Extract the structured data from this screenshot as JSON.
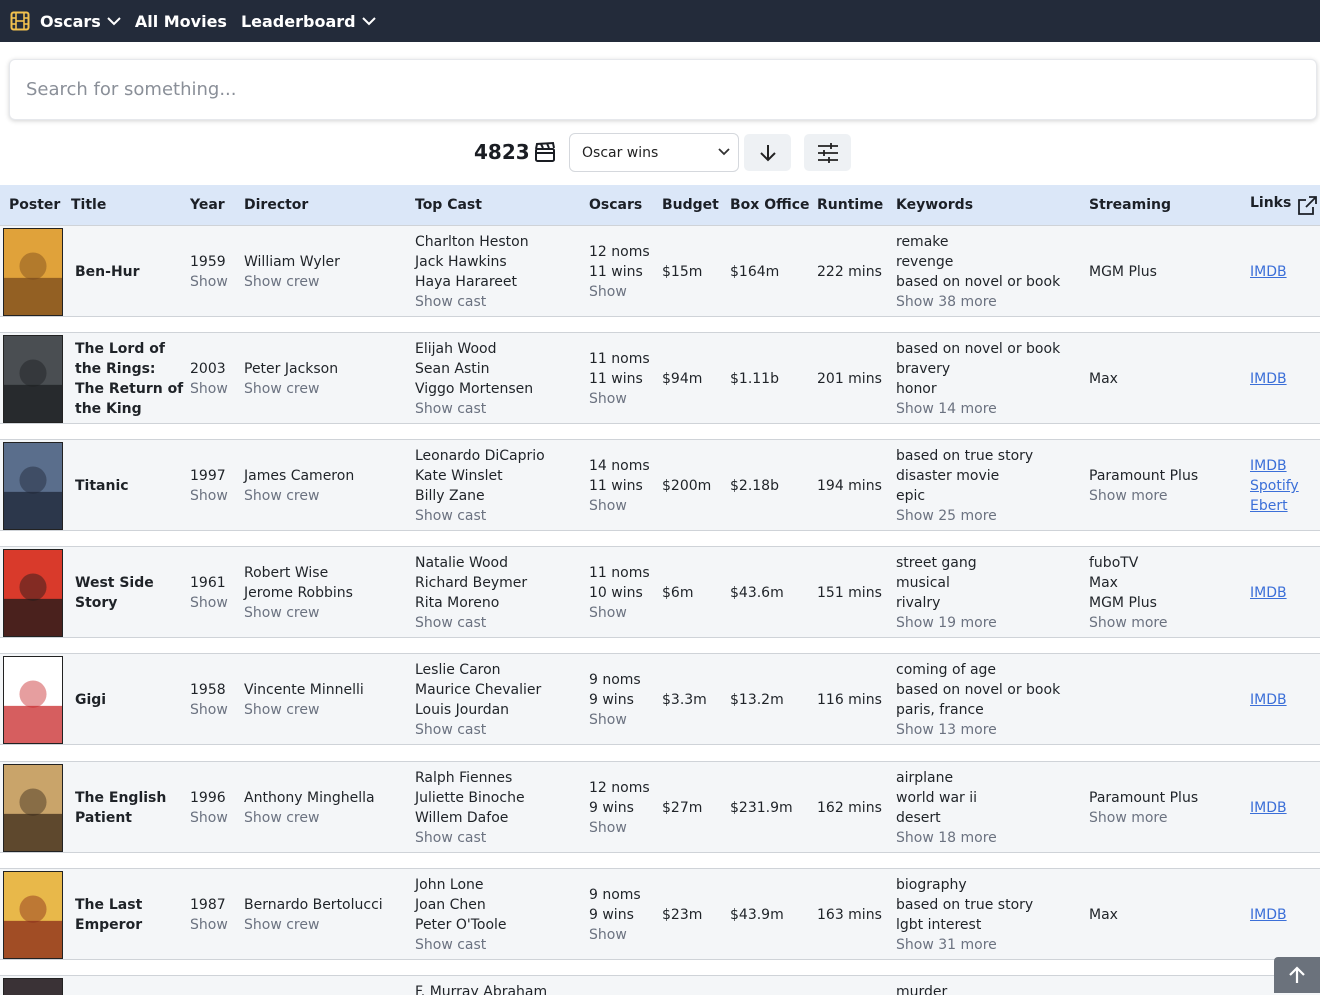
{
  "nav": {
    "brand": "Oscars",
    "all_movies": "All Movies",
    "leaderboard": "Leaderboard"
  },
  "search": {
    "placeholder": "Search for something..."
  },
  "controls": {
    "count": "4823",
    "sort_by": "Oscar wins"
  },
  "table": {
    "headers": {
      "poster": "Poster",
      "title": "Title",
      "year": "Year",
      "director": "Director",
      "top_cast": "Top Cast",
      "oscars": "Oscars",
      "budget": "Budget",
      "box_office": "Box Office",
      "runtime": "Runtime",
      "keywords": "Keywords",
      "streaming": "Streaming",
      "links": "Links"
    },
    "rows": [
      {
        "title": [
          "Ben-Hur"
        ],
        "year": "1959",
        "show": "Show",
        "directors": [
          "William Wyler"
        ],
        "show_crew": "Show crew",
        "cast": [
          "Charlton Heston",
          "Jack Hawkins",
          "Haya Harareet"
        ],
        "show_cast": "Show cast",
        "noms": "12 noms",
        "wins": "11 wins",
        "oscar_show": "Show",
        "budget": "$15m",
        "box_office": "$164m",
        "runtime": "222 mins",
        "keywords": [
          "remake",
          "revenge",
          "based on novel or book"
        ],
        "keywords_more": "Show 38 more",
        "streaming": [
          "MGM Plus"
        ],
        "streaming_more": "",
        "links": [
          "IMDB"
        ],
        "poster_colors": [
          "#e0a23a",
          "#7a4a1c"
        ]
      },
      {
        "title": [
          "The Lord of",
          "the Rings:",
          "The Return of",
          "the King"
        ],
        "year": "2003",
        "show": "Show",
        "directors": [
          "Peter Jackson"
        ],
        "show_crew": "Show crew",
        "cast": [
          "Elijah Wood",
          "Sean Astin",
          "Viggo Mortensen"
        ],
        "show_cast": "Show cast",
        "noms": "11 noms",
        "wins": "11 wins",
        "oscar_show": "Show",
        "budget": "$94m",
        "box_office": "$1.11b",
        "runtime": "201 mins",
        "keywords": [
          "based on novel or book",
          "bravery",
          "honor"
        ],
        "keywords_more": "Show 14 more",
        "streaming": [
          "Max"
        ],
        "streaming_more": "",
        "links": [
          "IMDB"
        ],
        "poster_colors": [
          "#4a4e52",
          "#1c1f22"
        ]
      },
      {
        "title": [
          "Titanic"
        ],
        "year": "1997",
        "show": "Show",
        "directors": [
          "James Cameron"
        ],
        "show_crew": "Show crew",
        "cast": [
          "Leonardo DiCaprio",
          "Kate Winslet",
          "Billy Zane"
        ],
        "show_cast": "Show cast",
        "noms": "14 noms",
        "wins": "11 wins",
        "oscar_show": "Show",
        "budget": "$200m",
        "box_office": "$2.18b",
        "runtime": "194 mins",
        "keywords": [
          "based on true story",
          "disaster movie",
          "epic"
        ],
        "keywords_more": "Show 25 more",
        "streaming": [
          "Paramount Plus"
        ],
        "streaming_more": "Show more",
        "links": [
          "IMDB",
          "Spotify",
          "Ebert"
        ],
        "poster_colors": [
          "#5a6e8c",
          "#1e2636"
        ]
      },
      {
        "title": [
          "West Side",
          "Story"
        ],
        "year": "1961",
        "show": "Show",
        "directors": [
          "Robert Wise",
          "Jerome Robbins"
        ],
        "show_crew": "Show crew",
        "cast": [
          "Natalie Wood",
          "Richard Beymer",
          "Rita Moreno"
        ],
        "show_cast": "Show cast",
        "noms": "11 noms",
        "wins": "10 wins",
        "oscar_show": "Show",
        "budget": "$6m",
        "box_office": "$43.6m",
        "runtime": "151 mins",
        "keywords": [
          "street gang",
          "musical",
          "rivalry"
        ],
        "keywords_more": "Show 19 more",
        "streaming": [
          "fuboTV",
          "Max",
          "MGM Plus"
        ],
        "streaming_more": "Show more",
        "links": [
          "IMDB"
        ],
        "poster_colors": [
          "#d93a2b",
          "#1a1a1a"
        ]
      },
      {
        "title": [
          "Gigi"
        ],
        "year": "1958",
        "show": "Show",
        "directors": [
          "Vincente Minnelli"
        ],
        "show_crew": "Show crew",
        "cast": [
          "Leslie Caron",
          "Maurice Chevalier",
          "Louis Jourdan"
        ],
        "show_cast": "Show cast",
        "noms": "9 noms",
        "wins": "9 wins",
        "oscar_show": "Show",
        "budget": "$3.3m",
        "box_office": "$13.2m",
        "runtime": "116 mins",
        "keywords": [
          "coming of age",
          "based on novel or book",
          "paris, france"
        ],
        "keywords_more": "Show 13 more",
        "streaming": [],
        "streaming_more": "",
        "links": [
          "IMDB"
        ],
        "poster_colors": [
          "#ffffff",
          "#c8282a"
        ]
      },
      {
        "title": [
          "The English",
          "Patient"
        ],
        "year": "1996",
        "show": "Show",
        "directors": [
          "Anthony Minghella"
        ],
        "show_crew": "Show crew",
        "cast": [
          "Ralph Fiennes",
          "Juliette Binoche",
          "Willem Dafoe"
        ],
        "show_cast": "Show cast",
        "noms": "12 noms",
        "wins": "9 wins",
        "oscar_show": "Show",
        "budget": "$27m",
        "box_office": "$231.9m",
        "runtime": "162 mins",
        "keywords": [
          "airplane",
          "world war ii",
          "desert"
        ],
        "keywords_more": "Show 18 more",
        "streaming": [
          "Paramount Plus"
        ],
        "streaming_more": "Show more",
        "links": [
          "IMDB"
        ],
        "poster_colors": [
          "#c9a46a",
          "#3a2a1a"
        ]
      },
      {
        "title": [
          "The Last",
          "Emperor"
        ],
        "year": "1987",
        "show": "Show",
        "directors": [
          "Bernardo Bertolucci"
        ],
        "show_crew": "Show crew",
        "cast": [
          "John Lone",
          "Joan Chen",
          "Peter O'Toole"
        ],
        "show_cast": "Show cast",
        "noms": "9 noms",
        "wins": "9 wins",
        "oscar_show": "Show",
        "budget": "$23m",
        "box_office": "$43.9m",
        "runtime": "163 mins",
        "keywords": [
          "biography",
          "based on true story",
          "lgbt interest"
        ],
        "keywords_more": "Show 31 more",
        "streaming": [
          "Max"
        ],
        "streaming_more": "",
        "links": [
          "IMDB"
        ],
        "poster_colors": [
          "#e8b84a",
          "#8a2a1a"
        ]
      }
    ],
    "partial_row": {
      "cast_first": "F. Murray Abraham",
      "keyword_first": "murder"
    }
  },
  "colors": {
    "nav_bg": "#232b3a",
    "header_bg": "#dbe7f8",
    "row_bg": "#f4f6f8",
    "link": "#3b6fd8",
    "muted": "#6b7280"
  }
}
